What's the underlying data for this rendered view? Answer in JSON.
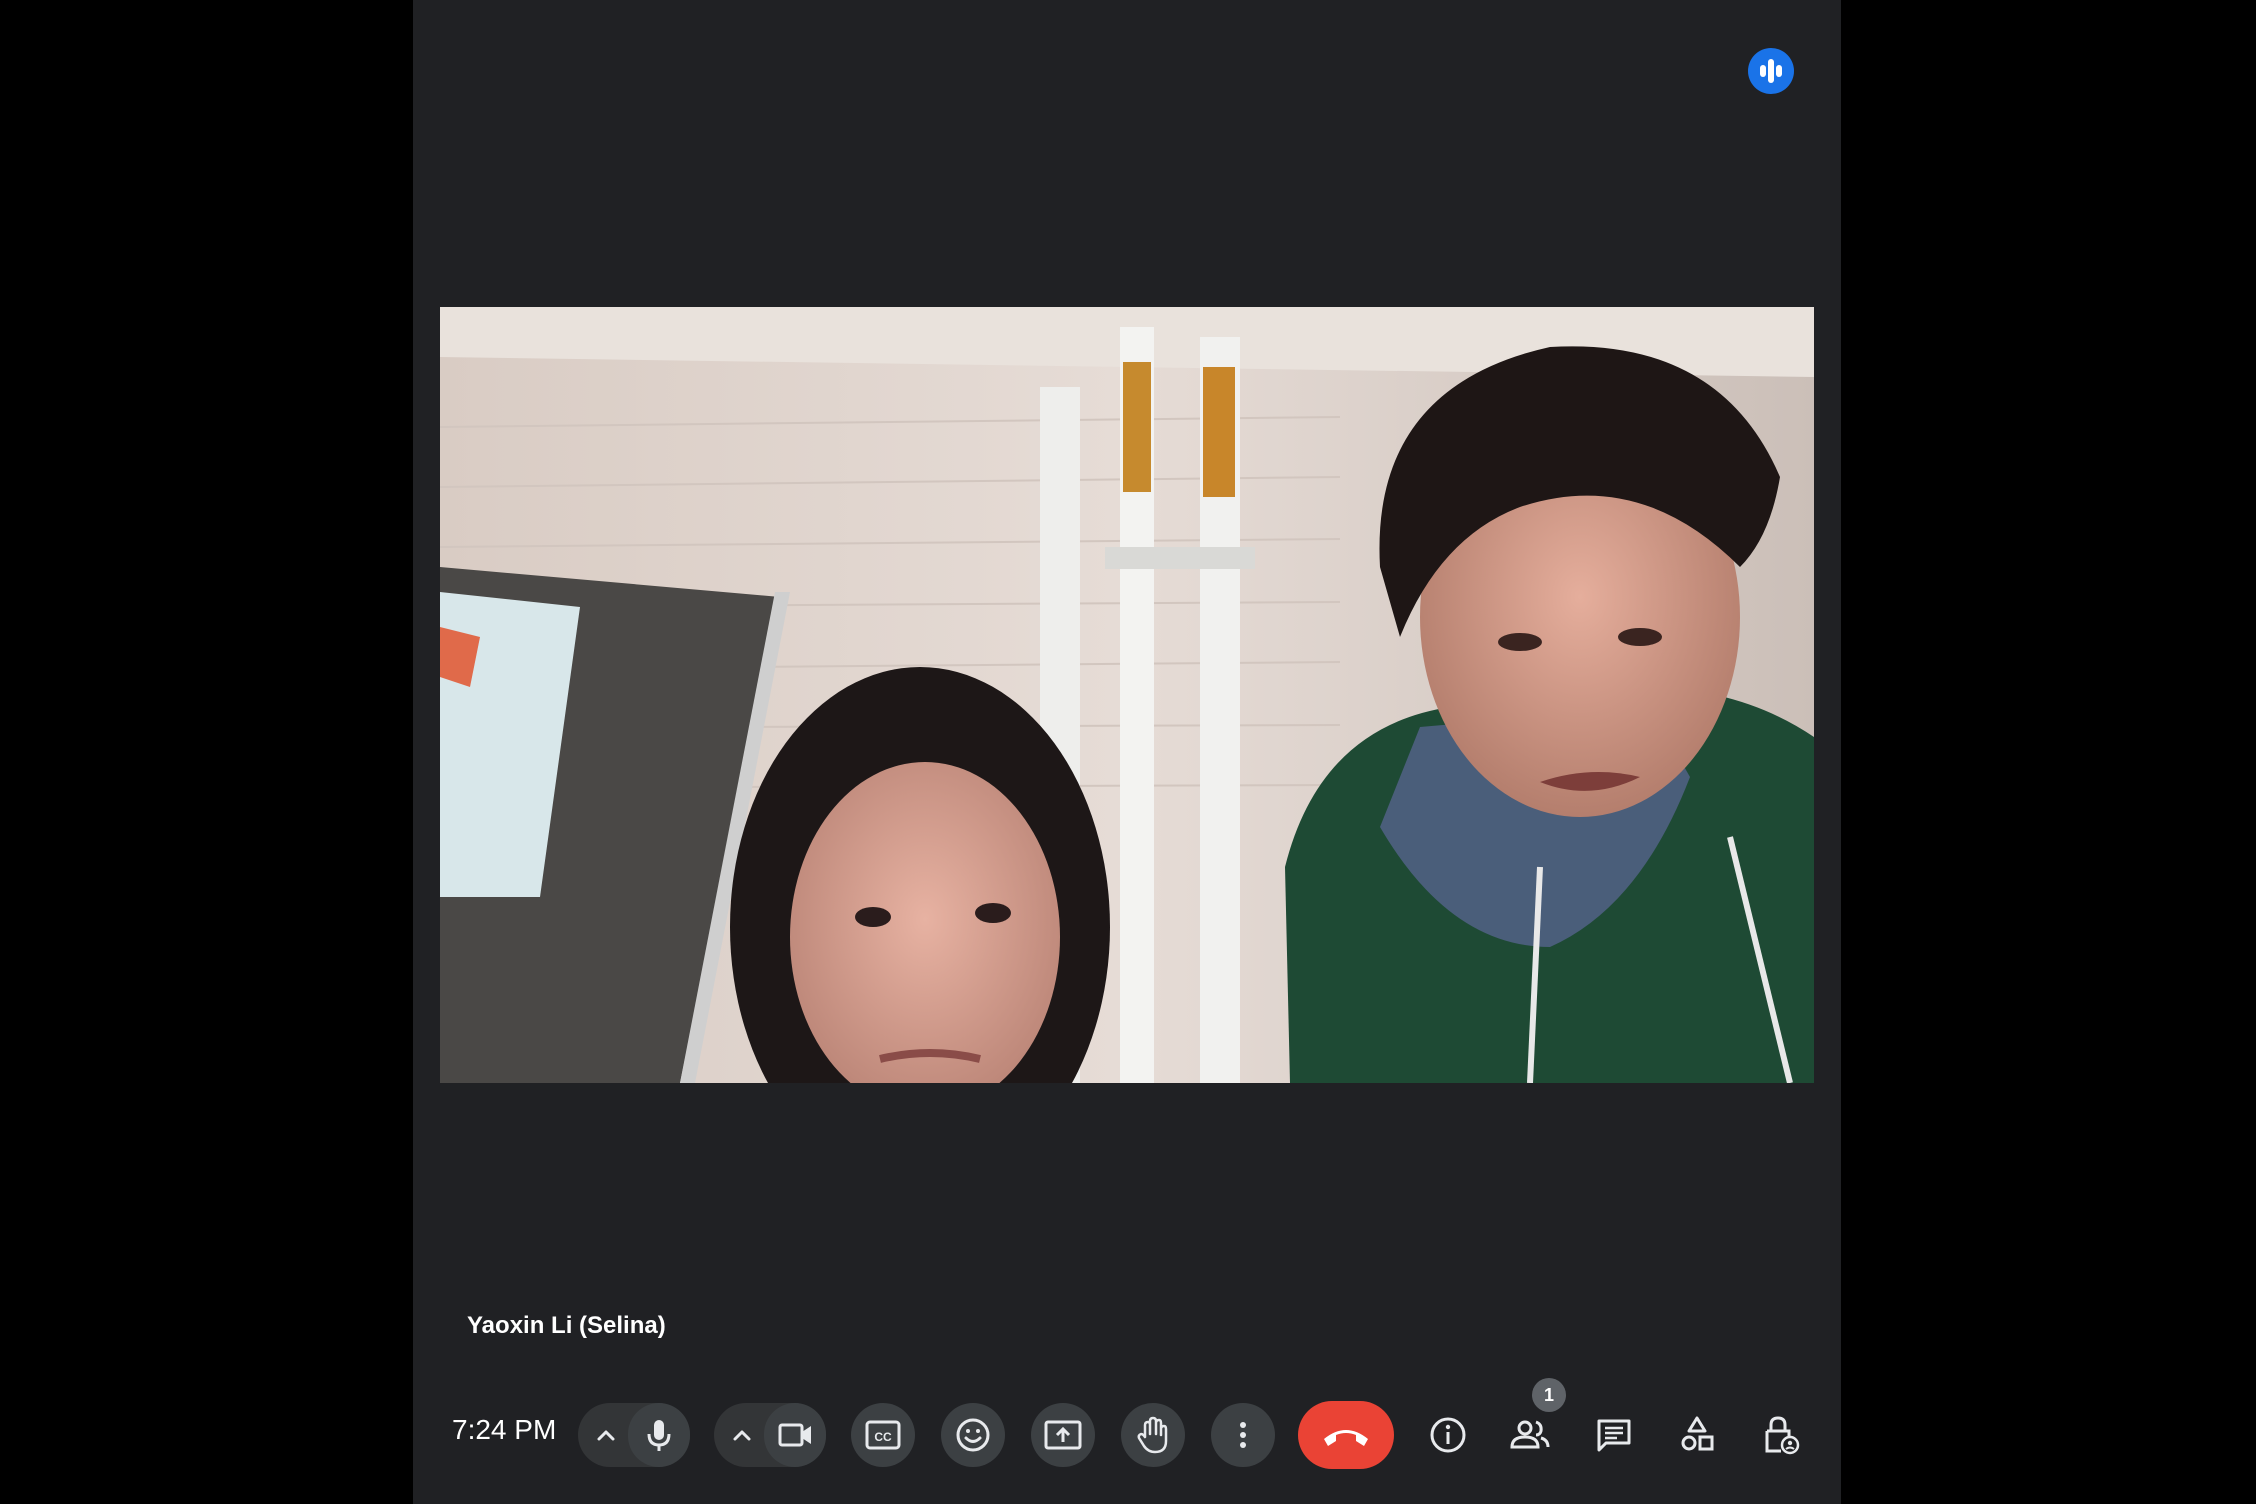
{
  "participant": {
    "name": "Yaoxin Li (Selina)"
  },
  "toolbar": {
    "time": "7:24 PM",
    "participants_count": "1"
  },
  "icons": {
    "speaking": "speaking-indicator-icon",
    "audio_options": "chevron-up-icon",
    "mic": "microphone-icon",
    "video_options": "chevron-up-icon",
    "camera": "videocam-icon",
    "captions": "closed-captions-icon",
    "reactions": "emoji-icon",
    "present": "present-screen-icon",
    "raise_hand": "hand-icon",
    "more": "more-vertical-icon",
    "end_call": "hang-up-icon",
    "info": "info-icon",
    "people": "people-icon",
    "chat": "chat-icon",
    "activities": "activities-icon",
    "host_controls": "lock-person-icon"
  },
  "colors": {
    "background": "#202124",
    "button": "#3c4043",
    "end_call": "#ea4335",
    "speaking_accent": "#1a73e8"
  }
}
